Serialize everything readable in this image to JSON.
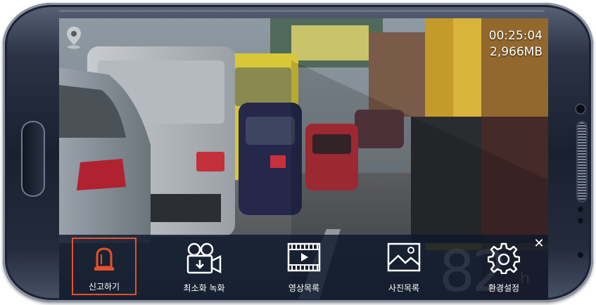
{
  "overlay": {
    "time": "00:25:04",
    "storage": "2,966MB",
    "speed_value": "82",
    "speed_unit": "h"
  },
  "toolbar": {
    "items": [
      {
        "label": "신고하기",
        "icon": "siren-icon",
        "active": true
      },
      {
        "label": "최소화 녹화",
        "icon": "video-camera-icon",
        "active": false
      },
      {
        "label": "영상목록",
        "icon": "video-list-icon",
        "active": false
      },
      {
        "label": "사진목록",
        "icon": "photo-list-icon",
        "active": false
      },
      {
        "label": "환경설정",
        "icon": "gear-icon",
        "active": false
      }
    ],
    "close_icon": "close-icon"
  },
  "colors": {
    "accent": "#e8502a",
    "toolbar_bg": "#0c182c",
    "text": "#ffffff"
  }
}
